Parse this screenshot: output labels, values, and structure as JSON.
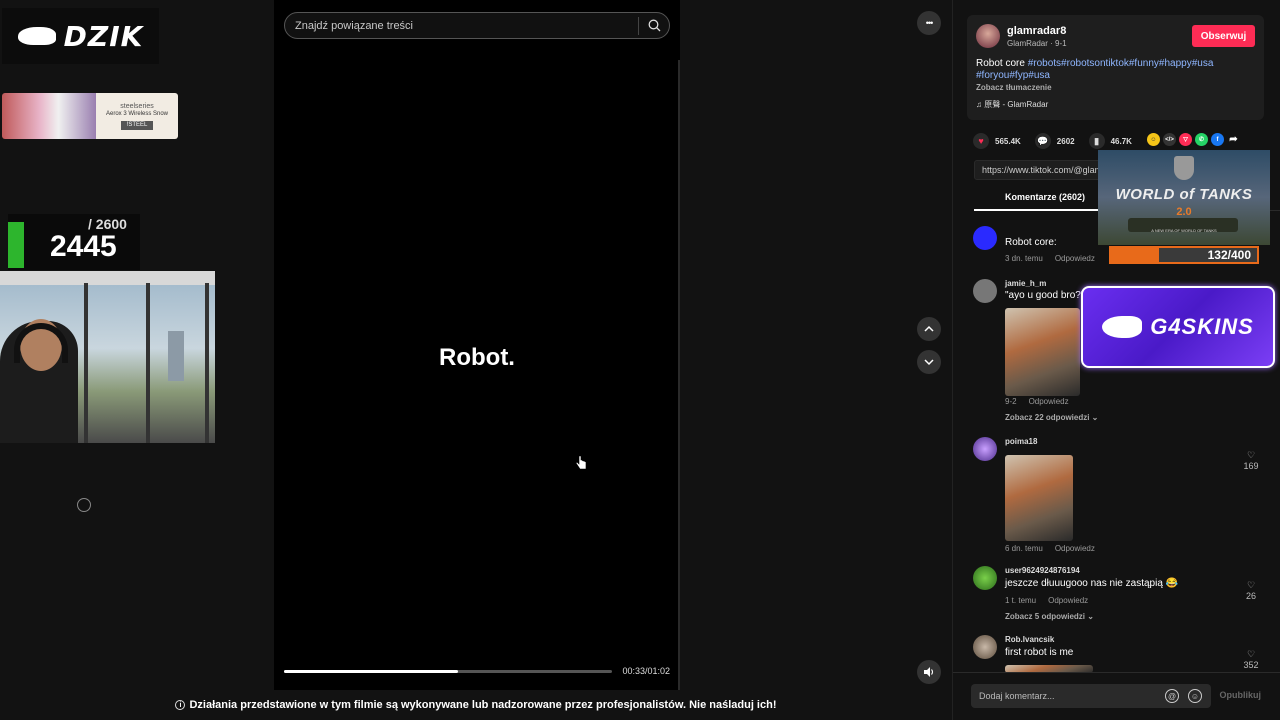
{
  "overlay": {
    "logo_text": "DZIK",
    "sponsor": {
      "brand": "steelseries",
      "product": "Aerox 3 Wireless Snow",
      "cta": "!STEEL"
    },
    "counter": {
      "total": "/ 2600",
      "current": "2445"
    }
  },
  "video": {
    "search_placeholder": "Znajdź powiązane treści",
    "caption": "Robot.",
    "time": "00:33/01:02",
    "progress_fraction": 0.53,
    "disclaimer": "Działania przedstawione w tym filmie są wykonywane lub nadzorowane przez profesjonalistów. Nie naśladuj ich!"
  },
  "controls": {
    "more": "•••",
    "up": "︿",
    "down": "﹀",
    "volume": "🔊"
  },
  "author": {
    "name": "glamradar8",
    "sub": "GlamRadar · 9-1",
    "follow_label": "Obserwuj",
    "desc_text": "Robot core ",
    "desc_tags": "#robots#robotsontiktok#funny#happy#usa #foryou#fyp#usa",
    "translate": "Zobacz tłumaczenie",
    "music": "♫  原聲 - GlamRadar"
  },
  "stats": {
    "likes": "565.4K",
    "comments": "2602",
    "saves": "46.7K"
  },
  "link": "https://www.tiktok.com/@glamradar8",
  "tabs": {
    "comments": "Komentarze (2602)"
  },
  "comments": [
    {
      "user": "",
      "text": "Robot core:",
      "date": "3 dn. temu",
      "reply": "Odpowiedz",
      "replies": "",
      "likes": ""
    },
    {
      "user": "jamie_h_m",
      "text": "\"ayo u good bro?\"",
      "date": "9-2",
      "reply": "Odpowiedz",
      "replies": "Zobacz 22 odpowiedzi ⌄",
      "likes": ""
    },
    {
      "user": "poima18",
      "text": "",
      "date": "6 dn. temu",
      "reply": "Odpowiedz",
      "replies": "",
      "likes": "169"
    },
    {
      "user": "user9624924876194",
      "text": "jeszcze dłuuugooo nas nie zastąpią 😂",
      "date": "1 t. temu",
      "reply": "Odpowiedz",
      "replies": "Zobacz 5 odpowiedzi ⌄",
      "likes": "26"
    },
    {
      "user": "Rob.Ivancsik",
      "text": "first robot is me",
      "date": "",
      "reply": "",
      "replies": "",
      "likes": "352"
    }
  ],
  "comment_box": {
    "placeholder": "Dodaj komentarz...",
    "publish": "Opublikuj"
  },
  "ads": {
    "wot": {
      "title": "WORLD of TANKS",
      "version": "2.0",
      "subtitle": "A NEW ERA OF WORLD OF TANKS"
    },
    "goal": {
      "text": "132/400",
      "fraction": 0.33
    },
    "g4": {
      "text": "G4SKINS"
    }
  },
  "colors": {
    "accent": "#fe2c55",
    "tag": "#8fb6ff",
    "goal": "#e86a1a",
    "g4": "#6a2ef0"
  }
}
